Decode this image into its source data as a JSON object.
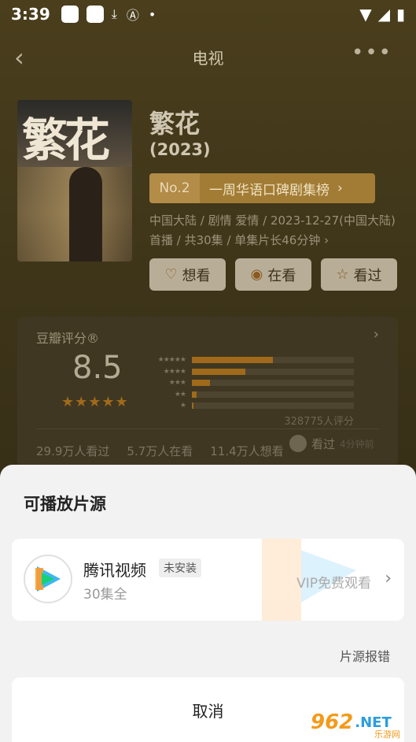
{
  "status_bar": {
    "time": "3:39"
  },
  "nav": {
    "back": "‹",
    "title": "电视",
    "more": "•••"
  },
  "movie": {
    "title": "繁花",
    "year": "(2023)",
    "rank_no": "No.2",
    "rank_text": "一周华语口碑剧集榜",
    "meta": "中国大陆 / 剧情 爱情 / 2023-12-27(中国大陆)首播 / 共30集 / 单集片长46分钟 ›"
  },
  "actions": [
    {
      "label": "想看",
      "icon": "heart-plus-icon"
    },
    {
      "label": "在看",
      "icon": "target-icon"
    },
    {
      "label": "看过",
      "icon": "star-outline-icon"
    }
  ],
  "rating": {
    "label": "豆瓣评分®",
    "score": "8.5",
    "stars": "★★★★★",
    "distribution": [
      {
        "stars": "★★★★★",
        "percent": 50
      },
      {
        "stars": "★★★★",
        "percent": 33
      },
      {
        "stars": "★★★",
        "percent": 11
      },
      {
        "stars": "★★",
        "percent": 3
      },
      {
        "stars": "★",
        "percent": 1
      }
    ],
    "count": "328775人评分",
    "watched": "29.9万人看过",
    "watching": "5.7万人在看",
    "want": "11.4万人想看",
    "seen_label": "看过",
    "seen_sub": "4分钟前"
  },
  "sheet": {
    "title": "可播放片源",
    "source_name": "腾讯视频",
    "source_badge": "未安装",
    "source_eps": "30集全",
    "source_vip": "VIP免费观看",
    "report": "片源报错",
    "cancel": "取消"
  },
  "watermark": {
    "brand": "962",
    "domain": ".NET",
    "sub": "乐游网"
  },
  "colors": {
    "accent": "#a06a1a",
    "rank_bg": "#a27c35",
    "sheet_bg": "#f2f2f2"
  }
}
